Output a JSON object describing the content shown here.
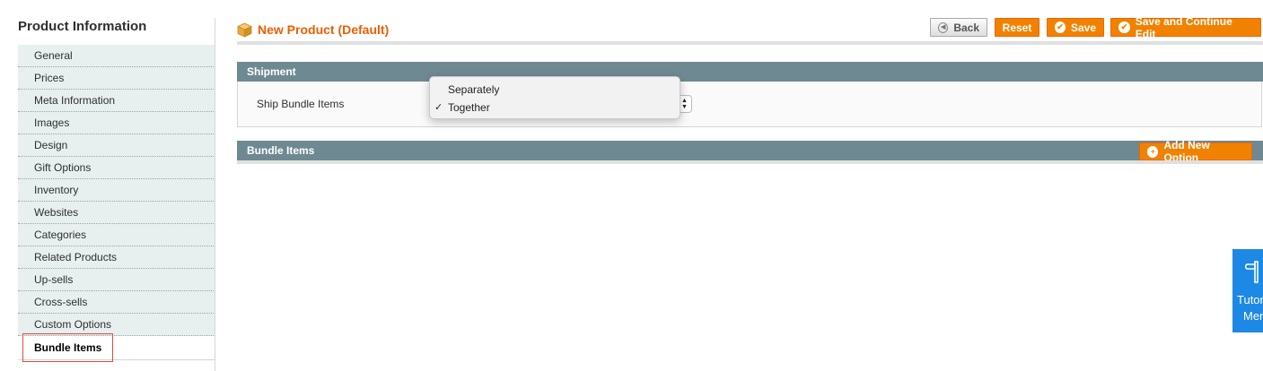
{
  "sidebar": {
    "title": "Product Information",
    "items": [
      {
        "label": "General"
      },
      {
        "label": "Prices"
      },
      {
        "label": "Meta Information"
      },
      {
        "label": "Images"
      },
      {
        "label": "Design"
      },
      {
        "label": "Gift Options"
      },
      {
        "label": "Inventory"
      },
      {
        "label": "Websites"
      },
      {
        "label": "Categories"
      },
      {
        "label": "Related Products"
      },
      {
        "label": "Up-sells"
      },
      {
        "label": "Cross-sells"
      },
      {
        "label": "Custom Options"
      },
      {
        "label": "Bundle Items",
        "active": true
      }
    ]
  },
  "header": {
    "title": "New Product (Default)",
    "icon": "product-box-icon",
    "buttons": {
      "back": "Back",
      "reset": "Reset",
      "save": "Save",
      "save_continue": "Save and Continue Edit"
    }
  },
  "shipment": {
    "section_title": "Shipment",
    "field_label": "Ship Bundle Items",
    "dropdown": {
      "options": [
        "Separately",
        "Together"
      ],
      "selected": "Together"
    }
  },
  "bundle": {
    "section_title": "Bundle Items",
    "add_option_label": "Add New Option"
  },
  "tutorial": {
    "line1": "Tutor",
    "line2": "Men"
  },
  "colors": {
    "accent_orange": "#f18200",
    "title_orange": "#eb5e00",
    "section_header": "#6f8992",
    "sidebar_bg": "#e7efef",
    "highlight_red": "#e2483a",
    "tutorial_blue": "#1e88e5"
  }
}
